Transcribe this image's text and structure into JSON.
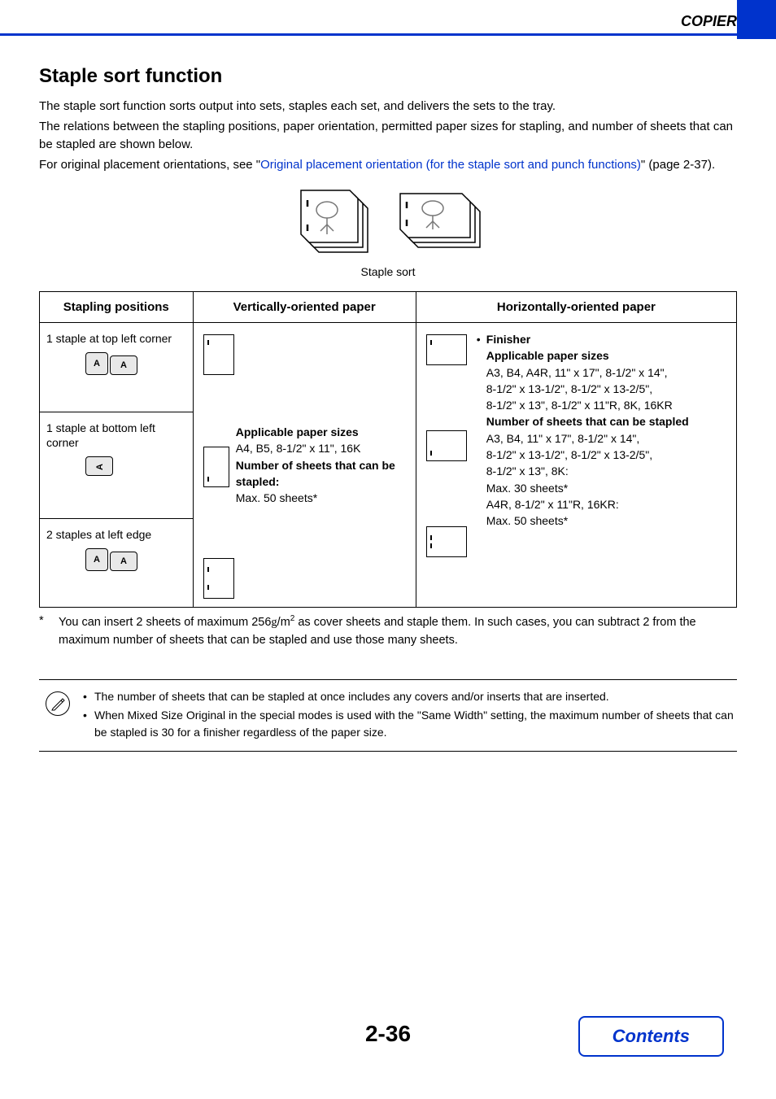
{
  "header": {
    "section": "COPIER"
  },
  "h1": "Staple sort function",
  "intro": {
    "p1": "The staple sort function sorts output into sets, staples each set, and delivers the sets to the tray.",
    "p2": "The relations between the stapling positions, paper orientation, permitted paper sizes for stapling, and number of sheets that can be stapled are shown below.",
    "p3_pre": "For original placement orientations, see \"",
    "p3_link": "Original placement orientation (for the staple sort and punch functions)",
    "p3_post": "\" (page 2-37)."
  },
  "illus_caption": "Staple sort",
  "table": {
    "headers": {
      "col1": "Stapling positions",
      "col2": "Vertically-oriented paper",
      "col3": "Horizontally-oriented paper"
    },
    "rows": {
      "r1_label": "1 staple at top left corner",
      "r2_label": "1 staple at bottom left corner",
      "r3_label": "2 staples at left edge"
    },
    "vertical_info": {
      "l1": "Applicable paper sizes",
      "l2": "A4, B5, 8-1/2\" x 11\", 16K",
      "l3": "Number of sheets that can be stapled:",
      "l4": "Max. 50 sheets*"
    },
    "horiz_info": {
      "bullet": "Finisher",
      "l1": "Applicable paper sizes",
      "l2": "A3, B4, A4R, 11\" x 17\", 8-1/2\" x 14\",",
      "l3": "8-1/2\" x 13-1/2\", 8-1/2\" x 13-2/5\",",
      "l4": "8-1/2\" x 13\", 8-1/2\" x 11\"R, 8K, 16KR",
      "l5": "Number of sheets that can be stapled",
      "l6": "A3, B4, 11\" x 17\", 8-1/2\" x 14\",",
      "l7": "8-1/2\" x 13-1/2\", 8-1/2\" x 13-2/5\",",
      "l8": "8-1/2\" x 13\", 8K:",
      "l9": "Max. 30 sheets*",
      "l10": "A4R, 8-1/2\" x 11\"R, 16KR:",
      "l11": "Max. 50 sheets*"
    }
  },
  "footnote": {
    "mark": "*",
    "text_pre": "You can insert 2 sheets of maximum 256",
    "unit_g": "g",
    "unit_m": "/m",
    "sup2": "2",
    "text_post": " as cover sheets and staple them. In such cases, you can subtract 2 from the maximum number of sheets that can be stapled and use those many sheets."
  },
  "notes": {
    "b1": "The number of sheets that can be stapled at once includes any covers and/or inserts that are inserted.",
    "b2": "When Mixed Size Original in the special modes is used with the \"Same Width\" setting, the maximum number of sheets that can be stapled is 30 for a finisher regardless of the paper size."
  },
  "page_num": "2-36",
  "contents_btn": "Contents",
  "icon_a": "A"
}
